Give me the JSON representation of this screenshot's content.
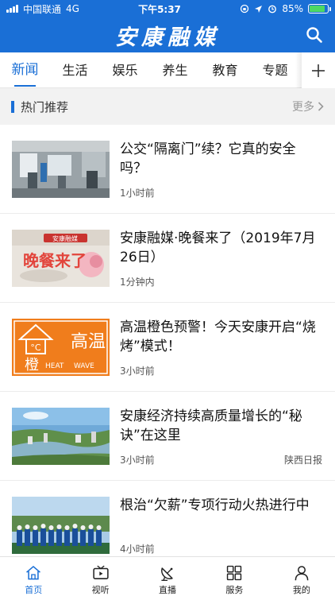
{
  "status_bar": {
    "carrier": "中国联通",
    "network": "4G",
    "time": "下午5:37",
    "battery": "85%",
    "battery_level": 0.85
  },
  "app_bar": {
    "title": "安康融媒",
    "search_icon": "search-icon"
  },
  "tabs": [
    {
      "label": "新闻",
      "active": true
    },
    {
      "label": "生活",
      "active": false
    },
    {
      "label": "娱乐",
      "active": false
    },
    {
      "label": "养生",
      "active": false
    },
    {
      "label": "教育",
      "active": false
    },
    {
      "label": "专题",
      "active": false
    }
  ],
  "add_tab_icon": "plus-icon",
  "section": {
    "title": "热门推荐",
    "more": "更多"
  },
  "news": [
    {
      "title": "公交“隔离门”续？它真的安全吗？",
      "time": "1小时前",
      "source": ""
    },
    {
      "title": "安康融媒·晚餐来了（2019年7月26日）",
      "time": "1分钟内",
      "source": ""
    },
    {
      "title": "高温橙色预警！今天安康开启“烧烤”模式！",
      "time": "3小时前",
      "source": ""
    },
    {
      "title": "安康经济持续高质量增长的“秘诀”在这里",
      "time": "3小时前",
      "source": "陕西日报"
    },
    {
      "title": "根治“欠薪”专项行动火热进行中",
      "time": "4小时前",
      "source": ""
    }
  ],
  "thumb_texts": {
    "dinner_banner": "安康融媒",
    "dinner_text": "晚餐来了",
    "warning_temp": "°C",
    "warning_label": "高温",
    "warning_orange": "橙",
    "warning_heat": "HEAT",
    "warning_wave": "WAVE"
  },
  "bottom_nav": [
    {
      "label": "首页",
      "icon": "home-icon",
      "active": true
    },
    {
      "label": "视听",
      "icon": "tv-icon",
      "active": false
    },
    {
      "label": "直播",
      "icon": "satellite-dish-icon",
      "active": false
    },
    {
      "label": "服务",
      "icon": "grid-icon",
      "active": false
    },
    {
      "label": "我的",
      "icon": "user-icon",
      "active": false
    }
  ],
  "colors": {
    "brand_blue": "#1a6fd6",
    "warning_orange": "#f07d1c"
  }
}
